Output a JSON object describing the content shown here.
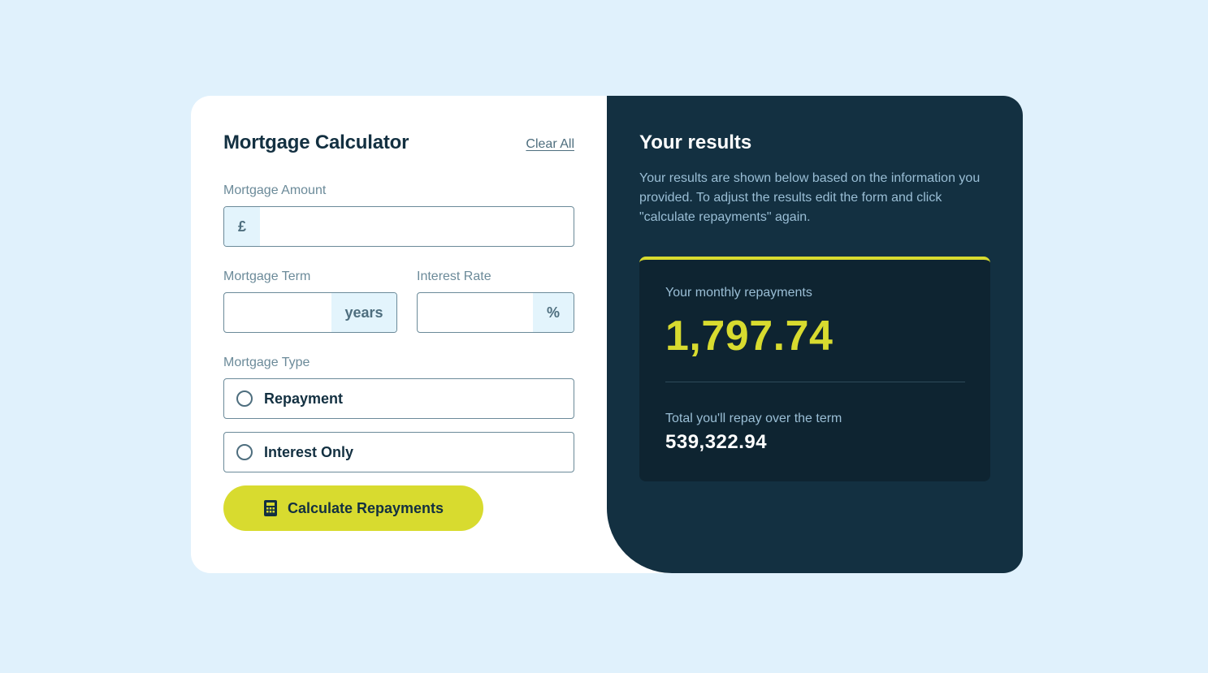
{
  "form": {
    "title": "Mortgage Calculator",
    "clear_all": "Clear All",
    "amount": {
      "label": "Mortgage Amount",
      "prefix": "£",
      "value": ""
    },
    "term": {
      "label": "Mortgage Term",
      "suffix": "years",
      "value": ""
    },
    "rate": {
      "label": "Interest Rate",
      "suffix": "%",
      "value": ""
    },
    "type": {
      "label": "Mortgage Type",
      "options": [
        {
          "label": "Repayment",
          "selected": false
        },
        {
          "label": "Interest Only",
          "selected": false
        }
      ]
    },
    "submit_label": "Calculate Repayments",
    "submit_icon": "calculator-icon"
  },
  "results": {
    "title": "Your results",
    "description": "Your results are shown below based on the information you provided. To adjust the results edit the form and click \"calculate repayments\" again.",
    "monthly_label": "Your monthly repayments",
    "monthly_value": "1,797.74",
    "total_label": "Total you'll repay over the term",
    "total_value": "539,322.94"
  },
  "colors": {
    "background": "#e0f1fc",
    "dark": "#133041",
    "accent": "#d8db2f",
    "slate": "#6b8a99"
  }
}
